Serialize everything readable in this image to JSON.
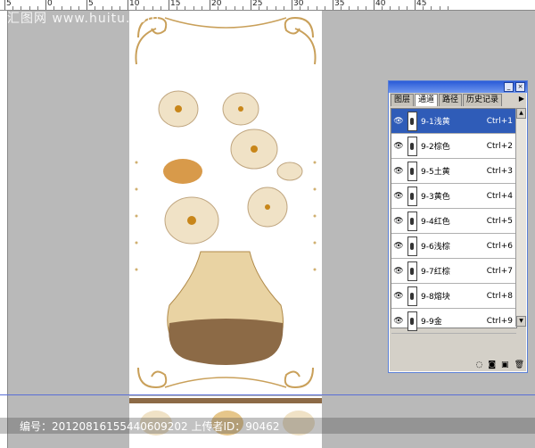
{
  "ruler": {
    "numbers": [
      "5",
      "0",
      "5",
      "10",
      "15",
      "20",
      "25",
      "30",
      "35",
      "40",
      "45"
    ]
  },
  "watermark": {
    "top": "汇图网 www.huitu.com",
    "bottom": "编号：20120816155440609202 上传者ID：90462"
  },
  "panel": {
    "tabs": [
      "图层",
      "通道",
      "路径",
      "历史记录"
    ],
    "channels": [
      {
        "name": "9-1浅黄",
        "shortcut": "Ctrl+1"
      },
      {
        "name": "9-2棕色",
        "shortcut": "Ctrl+2"
      },
      {
        "name": "9-5土黄",
        "shortcut": "Ctrl+3"
      },
      {
        "name": "9-3黄色",
        "shortcut": "Ctrl+4"
      },
      {
        "name": "9-4红色",
        "shortcut": "Ctrl+5"
      },
      {
        "name": "9-6浅棕",
        "shortcut": "Ctrl+6"
      },
      {
        "name": "9-7红棕",
        "shortcut": "Ctrl+7"
      },
      {
        "name": "9-8熔块",
        "shortcut": "Ctrl+8"
      },
      {
        "name": "9-9金",
        "shortcut": "Ctrl+9"
      }
    ],
    "icons": [
      "dotted-circle-icon",
      "mask-icon",
      "new-channel-icon",
      "trash-icon"
    ],
    "accent": "#2f5cb8"
  }
}
